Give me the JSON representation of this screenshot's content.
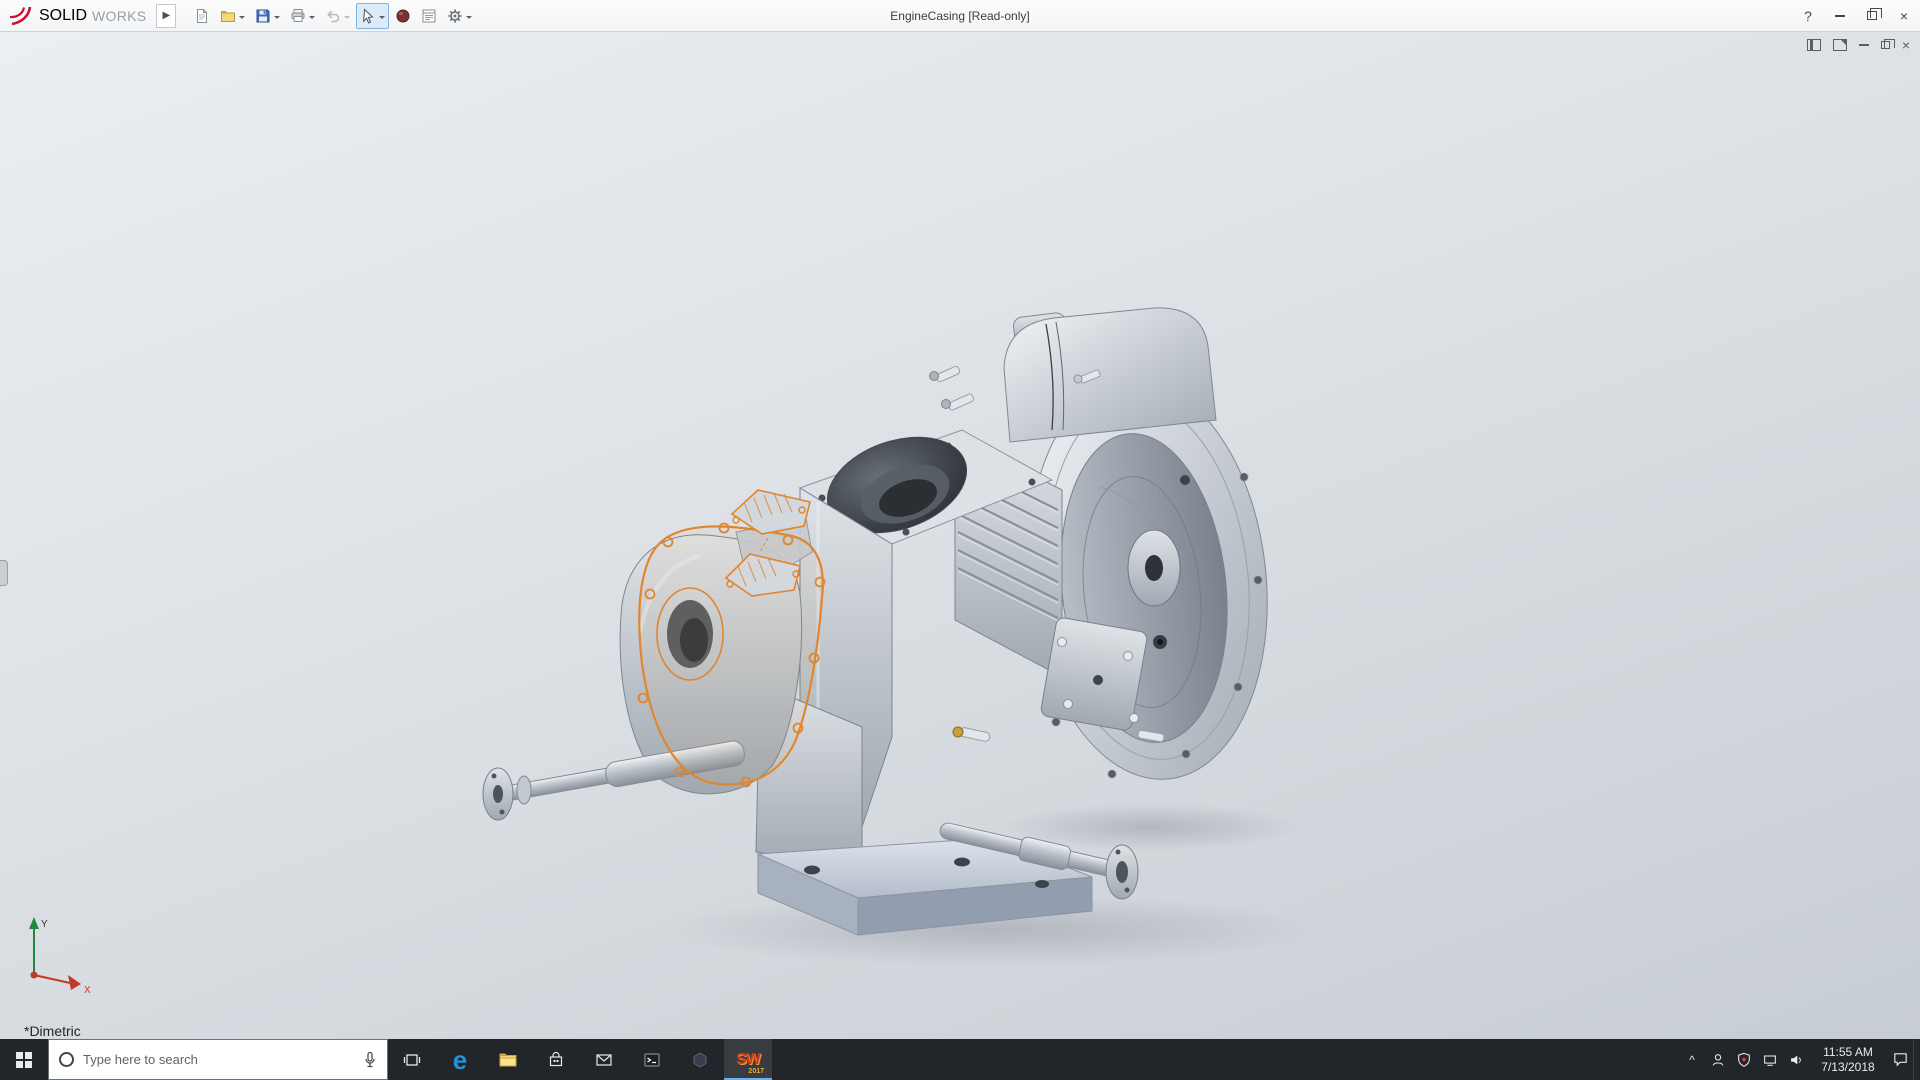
{
  "window": {
    "title": "EngineCasing [Read-only]",
    "help": "?",
    "close": "×"
  },
  "brand": {
    "solid": "SOLID",
    "works": "WORKS",
    "expander": "▶"
  },
  "toolbar": {
    "items": [
      {
        "name": "new-document"
      },
      {
        "name": "open-document"
      },
      {
        "name": "save"
      },
      {
        "name": "print"
      },
      {
        "name": "undo",
        "state": "disabled"
      },
      {
        "name": "select-tool",
        "state": "active"
      },
      {
        "name": "view-sphere"
      },
      {
        "name": "task-pane"
      },
      {
        "name": "options-gear"
      }
    ]
  },
  "doc_window": {
    "close": "×",
    "controls": [
      "pane",
      "fold",
      "minimize",
      "restore",
      "close"
    ]
  },
  "viewport": {
    "view_label": "*Dimetric",
    "axis_x": "X",
    "axis_y": "Y",
    "model": "engine-casing-assembly",
    "selection_color": "#e0862e"
  },
  "taskbar": {
    "search_placeholder": "Type here to search",
    "apps": [
      "start",
      "task-view",
      "edge",
      "file-explorer",
      "store",
      "mail",
      "terminal",
      "app-dark",
      "solidworks"
    ],
    "edge_glyph": "e",
    "sw_glyph": "SW",
    "sw_year": "2017",
    "tray_caret": "^",
    "tray_icons": [
      "people",
      "defender",
      "network",
      "volume"
    ],
    "clock": {
      "time": "11:55 AM",
      "date": "7/13/2018"
    }
  },
  "colors": {
    "selection_orange": "#e0862e",
    "taskbar_bg": "#22252a",
    "active_accent": "#6cb2e8"
  }
}
